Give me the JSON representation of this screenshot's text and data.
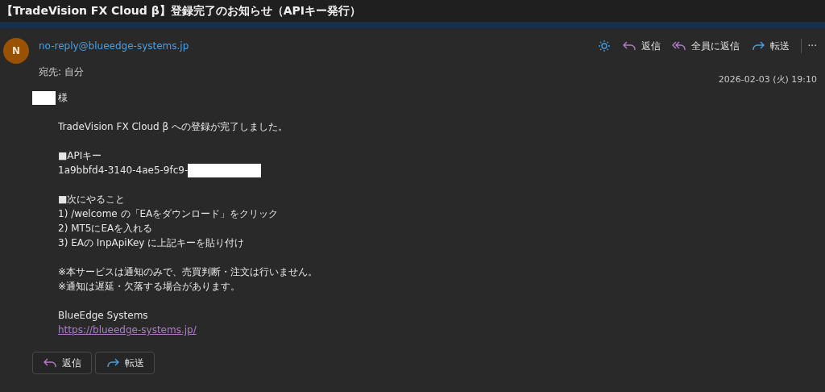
{
  "subject": "【TradeVision FX Cloud β】登録完了のお知らせ（APIキー発行）",
  "sender": {
    "initial": "N",
    "address": "no-reply@blueedge-systems.jp",
    "to_label": "宛先:",
    "to": "自分",
    "date": "2026-02-03 (火) 19:10"
  },
  "actions": [
    {
      "kind": "sun"
    },
    {
      "kind": "reply",
      "label": "返信"
    },
    {
      "kind": "reply_all",
      "label": "全員に返信"
    },
    {
      "kind": "forward",
      "label": "転送"
    },
    {
      "kind": "more",
      "label": "···"
    }
  ],
  "greeting": {
    "suffix": "様",
    "redacted": true
  },
  "paragraphs": [
    [
      {
        "text": "TradeVision FX Cloud β への登録が完了しました。",
        "redacted": false
      }
    ],
    [
      {
        "text": "■APIキー",
        "redacted": false
      },
      {
        "text": "1a9bbfd4-3140-4ae5-9fc9-",
        "redacted": true
      }
    ],
    [
      {
        "text": "■次にやること",
        "redacted": false
      },
      {
        "text": "1) /welcome の「EAをダウンロード」をクリック",
        "redacted": false
      },
      {
        "text": "2) MT5にEAを入れる",
        "redacted": false
      },
      {
        "text": "3) EAの InpApiKey に上記キーを貼り付け",
        "redacted": false
      }
    ],
    [
      {
        "text": "※本サービスは通知のみで、売買判断・注文は行いません。",
        "redacted": false
      },
      {
        "text": "※通知は遅延・欠落する場合があります。",
        "redacted": false
      }
    ],
    [
      {
        "text": "BlueEdge Systems",
        "redacted": false
      }
    ]
  ],
  "link": "https://blueedge-systems.jp/",
  "buttons": [
    {
      "kind": "reply",
      "label": "返信"
    },
    {
      "kind": "forward",
      "label": "転送"
    }
  ]
}
